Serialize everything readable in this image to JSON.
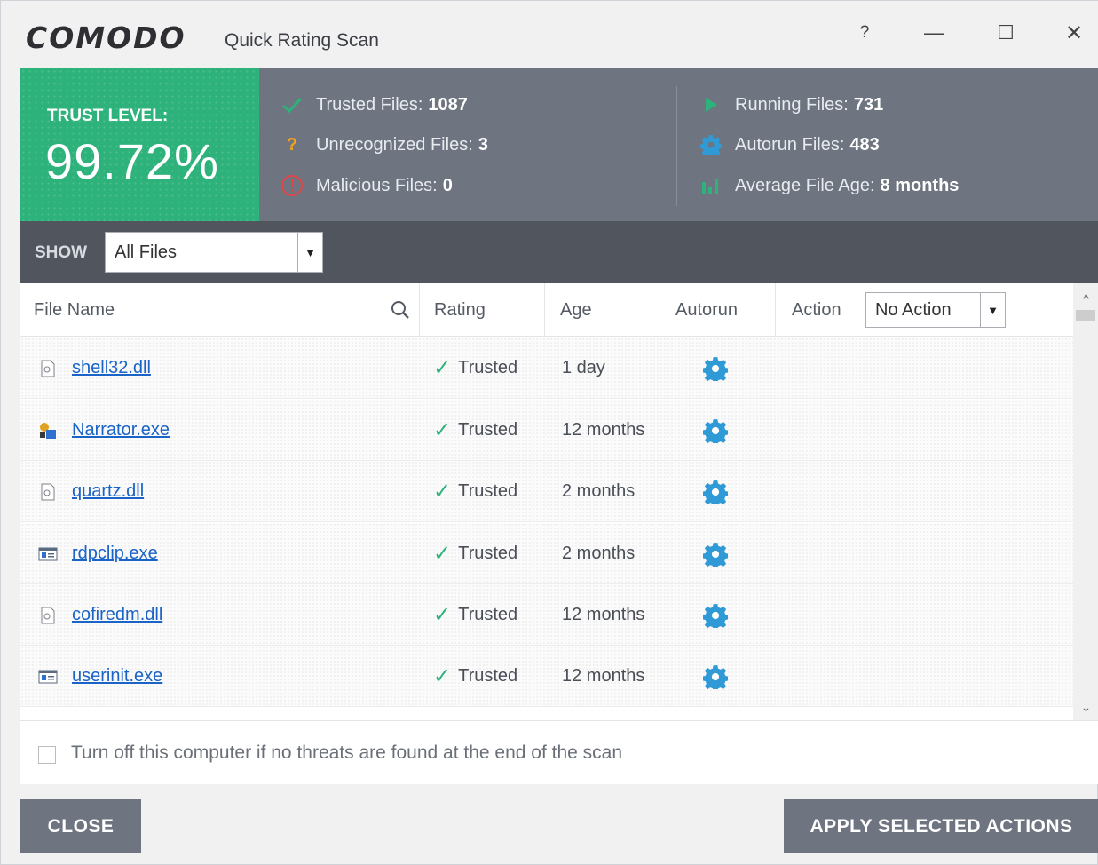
{
  "window": {
    "brand": "COMODO",
    "title": "Quick Rating Scan",
    "help_label": "?",
    "minimize_label": "—",
    "maximize_label": "☐",
    "close_label": "✕"
  },
  "trust": {
    "label": "TRUST LEVEL:",
    "value": "99.72%",
    "color": "#2cb27a"
  },
  "stats": {
    "trusted": {
      "label": "Trusted Files:",
      "value": "1087",
      "icon": "checkmark-icon"
    },
    "unrecognized": {
      "label": "Unrecognized Files:",
      "value": "3",
      "icon": "question-icon"
    },
    "malicious": {
      "label": "Malicious Files:",
      "value": "0",
      "icon": "alert-circle-icon"
    },
    "running": {
      "label": "Running Files:",
      "value": "731",
      "icon": "play-icon"
    },
    "autorun": {
      "label": "Autorun Files:",
      "value": "483",
      "icon": "gear-icon"
    },
    "age": {
      "label": "Average File Age:",
      "value": "8 months",
      "icon": "bar-chart-icon"
    }
  },
  "filter": {
    "show_label": "SHOW",
    "selected": "All Files"
  },
  "table": {
    "columns": {
      "file_name": "File Name",
      "rating": "Rating",
      "age": "Age",
      "autorun": "Autorun",
      "action": "Action"
    },
    "action_selected": "No Action",
    "rows": [
      {
        "name": "shell32.dll",
        "icon": "dll-file-icon",
        "rating": "Trusted",
        "age": "1 day"
      },
      {
        "name": "Narrator.exe",
        "icon": "narrator-app-icon",
        "rating": "Trusted",
        "age": "12 months"
      },
      {
        "name": "quartz.dll",
        "icon": "dll-file-icon",
        "rating": "Trusted",
        "age": "2 months"
      },
      {
        "name": "rdpclip.exe",
        "icon": "exe-window-icon",
        "rating": "Trusted",
        "age": "2 months"
      },
      {
        "name": "cofiredm.dll",
        "icon": "dll-file-icon",
        "rating": "Trusted",
        "age": "12 months"
      },
      {
        "name": "userinit.exe",
        "icon": "exe-window-icon",
        "rating": "Trusted",
        "age": "12 months"
      }
    ]
  },
  "options": {
    "shutdown_label": "Turn off this computer if no threats are found at the end of the scan",
    "shutdown_checked": false
  },
  "buttons": {
    "close": "CLOSE",
    "apply": "APPLY SELECTED ACTIONS"
  },
  "colors": {
    "accent_green": "#2cb27a",
    "gear_blue": "#2f9ad6",
    "header_gray": "#6e7480",
    "bar_dark": "#50555e",
    "link_blue": "#1a63c7",
    "warn_orange": "#f4a21a",
    "danger_red": "#e04545"
  }
}
